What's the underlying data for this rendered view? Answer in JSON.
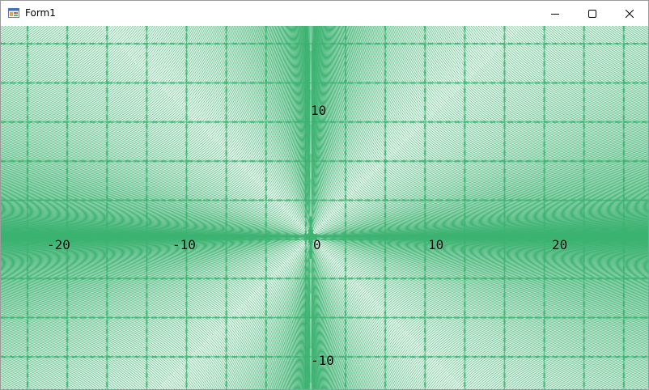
{
  "window": {
    "title": "Form1",
    "icon": "winforms-app-icon",
    "buttons": {
      "minimize": "minimize-icon",
      "maximize": "maximize-icon",
      "close": "close-icon"
    }
  },
  "plot": {
    "line_color": "#3cb371",
    "background": "#ffffff",
    "label_color": "#000000",
    "x_range": [
      -25,
      26
    ],
    "y_range": [
      -15,
      15
    ],
    "labels": {
      "x_neg20": "-20",
      "x_neg10": "-10",
      "origin": "0",
      "x_10": "10",
      "x_20": "20",
      "y_10": "10",
      "y_neg10": "-10"
    }
  }
}
